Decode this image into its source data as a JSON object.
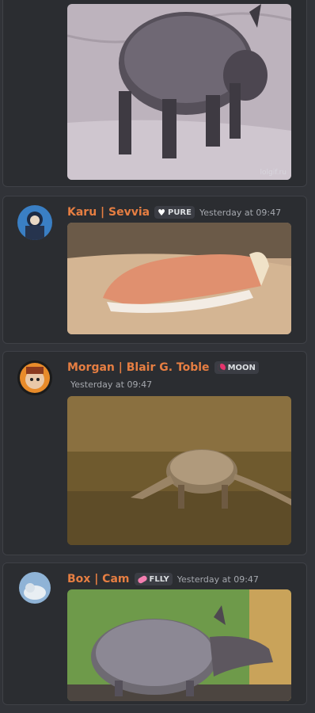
{
  "messages": [
    {
      "image_alt": "armadillo gif",
      "watermark": "lolgif.ru"
    },
    {
      "author": "Karu | Sevvia",
      "tag": "PURE",
      "tag_icon": "heart-icon",
      "timestamp": "Yesterday at 09:47",
      "image_alt": "pink fairy armadillo"
    },
    {
      "author": "Morgan | Blair G. Toble",
      "tag": "MOON",
      "tag_icon": "moon-icon",
      "timestamp": "Yesterday at 09:47",
      "image_alt": "nine-banded armadillo in grass"
    },
    {
      "author": "Box | Cam",
      "tag": "FLLY",
      "tag_icon": "pill-icon",
      "timestamp": "Yesterday at 09:47",
      "image_alt": "armadillo closeup"
    }
  ],
  "colors": {
    "background": "#313338",
    "card": "#2b2d31",
    "username": "#e67e42",
    "timestamp": "#a5a8ae"
  }
}
